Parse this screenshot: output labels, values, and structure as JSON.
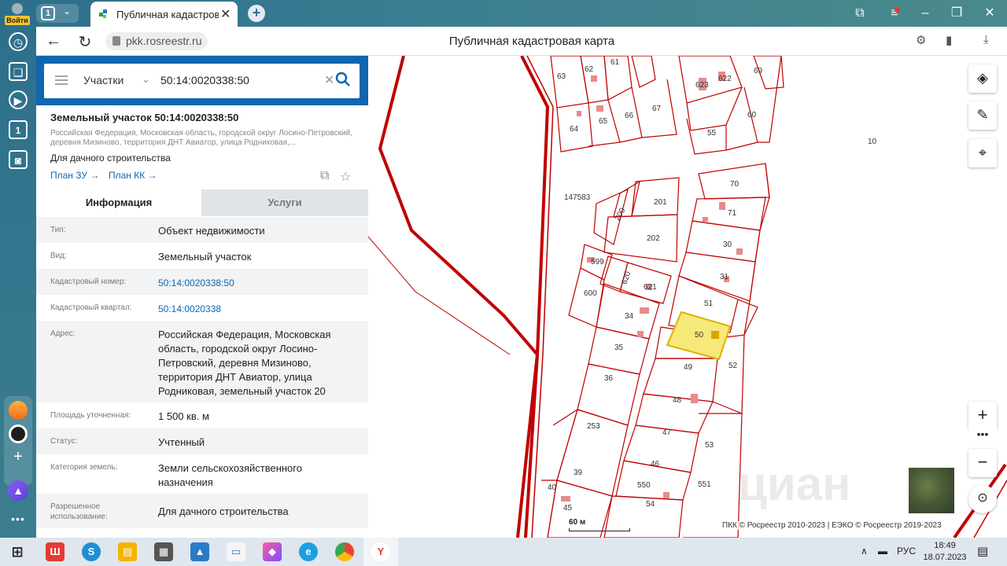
{
  "browser": {
    "login_label": "Войти",
    "tab_count": "1",
    "tab_title": "Публичная кадастровая",
    "url": "pkk.rosreestr.ru",
    "page_title": "Публичная кадастровая карта",
    "sidebar_counter": "1"
  },
  "search": {
    "type_label": "Участки",
    "query": "50:14:0020338:50"
  },
  "object": {
    "title": "Земельный участок 50:14:0020338:50",
    "address_short": "Российская Федерация, Московская область, городской округ Лосино-Петровский, деревня Мизиново, территория ДНТ Авиатор, улица Родниковая,...",
    "purpose": "Для дачного строительства",
    "plan_zu": "План ЗУ →",
    "plan_kk": "План КК →"
  },
  "tabs": {
    "info": "Информация",
    "services": "Услуги"
  },
  "info_rows": [
    {
      "key": "Тип:",
      "value": "Объект недвижимости"
    },
    {
      "key": "Вид:",
      "value": "Земельный участок"
    },
    {
      "key": "Кадастровый номер:",
      "value": "50:14:0020338:50"
    },
    {
      "key": "Кадастровый квартал:",
      "value": "50:14:0020338"
    },
    {
      "key": "Адрес:",
      "value": "Российская Федерация, Московская область, городской округ Лосино-Петровский, деревня Мизиново, территория ДНТ Авиатор, улица Родниковая, земельный участок 20"
    },
    {
      "key": "Площадь уточненная:",
      "value": "1 500 кв. м"
    },
    {
      "key": "Статус:",
      "value": "Учтенный"
    },
    {
      "key": "Категория земель:",
      "value": "Земли сельскохозяйственного назначения"
    },
    {
      "key": "Разрешенное использование:",
      "value": "Для дачного строительства"
    }
  ],
  "map": {
    "scale_label": "60 м",
    "copyright": "ПКК © Росреестр 2010-2023 | ЕЭКО © Росреестр 2019-2023",
    "watermark": "циан",
    "parcel_labels": [
      "63",
      "62",
      "61",
      "623",
      "622",
      "69",
      "64",
      "65",
      "66",
      "67",
      "55",
      "60",
      "10",
      "147583",
      "201",
      "200",
      "202",
      "70",
      "71",
      "30",
      "599",
      "620",
      "621",
      "600",
      "31",
      "51",
      "34",
      "35",
      "50",
      "49",
      "52",
      "36",
      "48",
      "253",
      "47",
      "53",
      "46",
      "39",
      "40",
      "45",
      "54",
      "550",
      "551"
    ]
  },
  "taskbar": {
    "lang": "РУС",
    "time": "18:49",
    "date": "18.07.2023"
  }
}
